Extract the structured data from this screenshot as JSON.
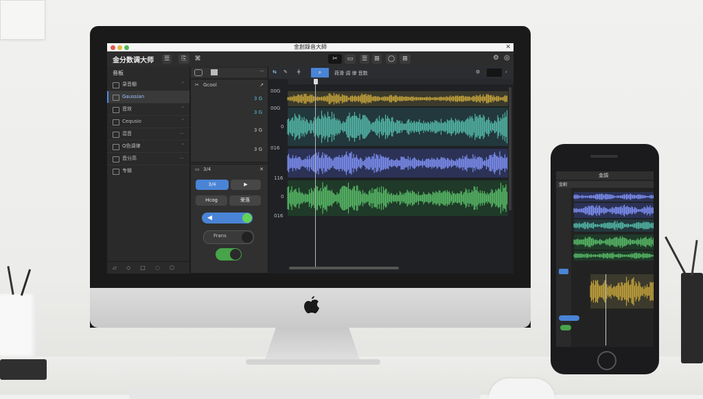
{
  "app": {
    "title": "金分数调大师",
    "window_title": "金創錄音大師"
  },
  "toolbar": {
    "b1": "⌘",
    "b2": "⎘",
    "b3": "✂",
    "b4": "▭",
    "b5": "☰",
    "b6": "◯",
    "b7": "⊞"
  },
  "sidebar": {
    "header": "音板",
    "items": [
      {
        "label": "录音棚",
        "chev": "˅"
      },
      {
        "label": "Gaussian",
        "chev": ""
      },
      {
        "label": "音效",
        "chev": "˅"
      },
      {
        "label": "Cequsio",
        "chev": "˅"
      },
      {
        "label": "混音",
        "chev": "···"
      },
      {
        "label": "Q色调律",
        "chev": "˅"
      },
      {
        "label": "音分高",
        "chev": "···"
      },
      {
        "label": "专辑",
        "chev": ""
      }
    ]
  },
  "inspector": {
    "tag": "Gcool",
    "rows": [
      "3 G",
      "3 G",
      "3 G",
      "3 G"
    ],
    "panel_title": "3/4",
    "play_label": "3/4",
    "btn_a": "Hcog",
    "btn_b": "荣落",
    "toggle_label": "Frans"
  },
  "wave": {
    "toolbar_text": "荷滑 调 律 音数",
    "labels": [
      "00G",
      "00G",
      "0",
      "016",
      "116",
      "0",
      "016"
    ]
  },
  "colors": {
    "yellow": "#c3a23a",
    "cyan": "#53b7a7",
    "blue": "#7d8ff0",
    "green": "#58b866",
    "accent": "#4a8fe6"
  },
  "phone": {
    "title": "金調",
    "bar": "金創"
  }
}
